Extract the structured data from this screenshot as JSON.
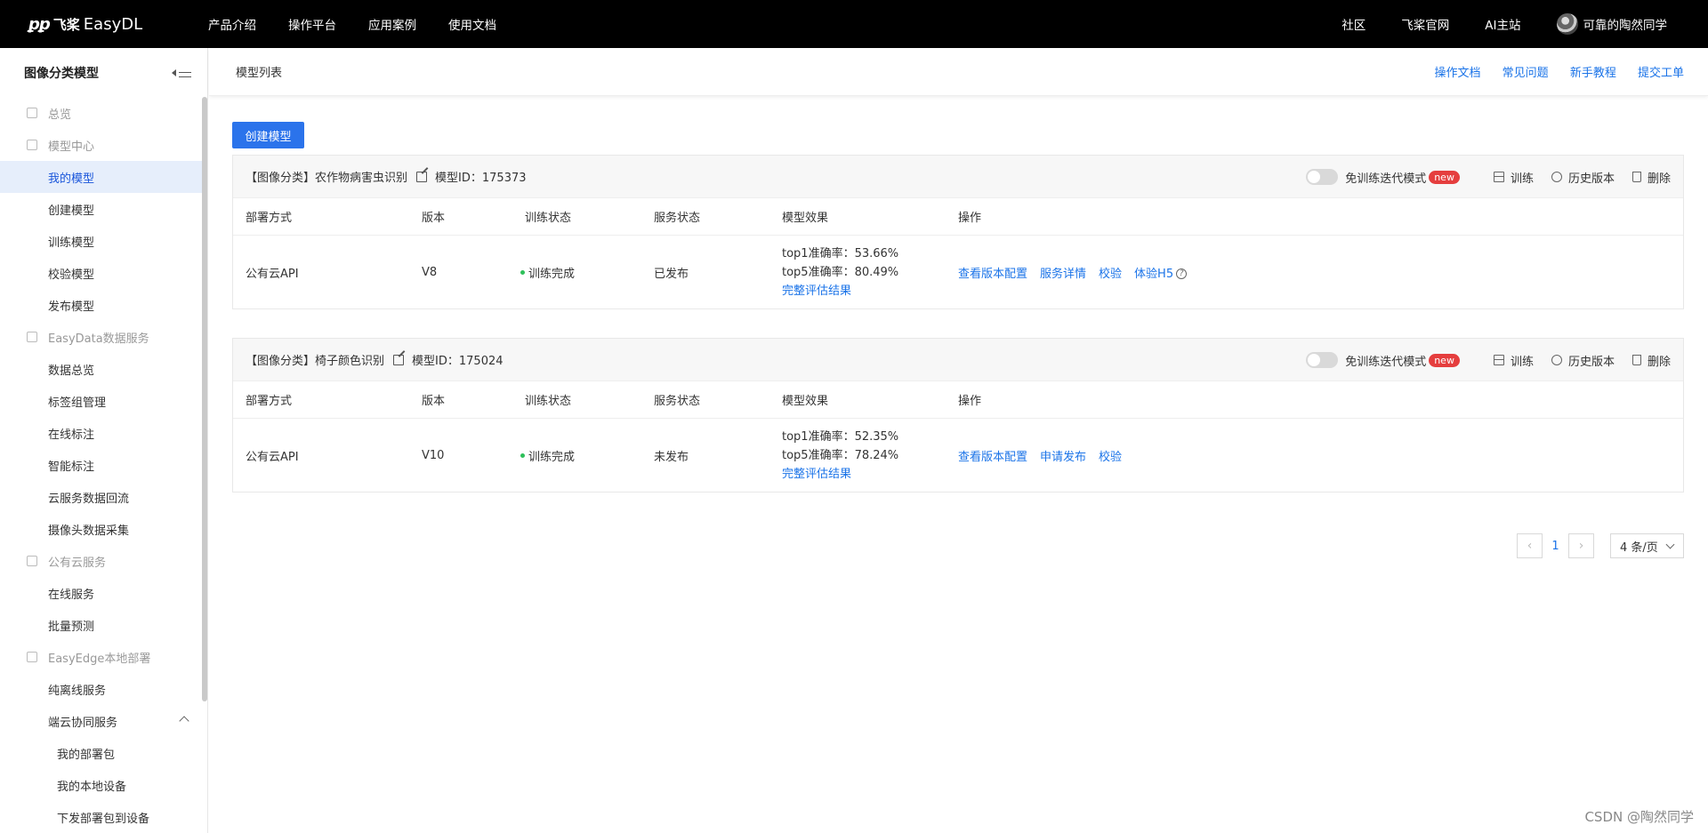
{
  "topnav": {
    "logo_mark": "ꝑꝑ",
    "logo_brand": "飞桨",
    "logo_product": "EasyDL",
    "menu": [
      "产品介绍",
      "操作平台",
      "应用案例",
      "使用文档"
    ],
    "right_links": [
      "社区",
      "飞桨官网",
      "AI主站"
    ],
    "username": "可靠的陶然同学"
  },
  "sidebar": {
    "title": "图像分类模型",
    "items": [
      {
        "label": "总览",
        "type": "group"
      },
      {
        "label": "模型中心",
        "type": "group"
      },
      {
        "label": "我的模型",
        "type": "item",
        "active": true
      },
      {
        "label": "创建模型",
        "type": "item"
      },
      {
        "label": "训练模型",
        "type": "item"
      },
      {
        "label": "校验模型",
        "type": "item"
      },
      {
        "label": "发布模型",
        "type": "item"
      },
      {
        "label": "EasyData数据服务",
        "type": "group"
      },
      {
        "label": "数据总览",
        "type": "item"
      },
      {
        "label": "标签组管理",
        "type": "item"
      },
      {
        "label": "在线标注",
        "type": "item"
      },
      {
        "label": "智能标注",
        "type": "item"
      },
      {
        "label": "云服务数据回流",
        "type": "item"
      },
      {
        "label": "摄像头数据采集",
        "type": "item"
      },
      {
        "label": "公有云服务",
        "type": "group"
      },
      {
        "label": "在线服务",
        "type": "item"
      },
      {
        "label": "批量预测",
        "type": "item"
      },
      {
        "label": "EasyEdge本地部署",
        "type": "group"
      },
      {
        "label": "纯离线服务",
        "type": "item"
      },
      {
        "label": "端云协同服务",
        "type": "item",
        "expanded": true
      },
      {
        "label": "我的部署包",
        "type": "sub"
      },
      {
        "label": "我的本地设备",
        "type": "sub"
      },
      {
        "label": "下发部署包到设备",
        "type": "sub"
      }
    ]
  },
  "main": {
    "breadcrumb": "模型列表",
    "header_links": [
      "操作文档",
      "常见问题",
      "新手教程",
      "提交工单"
    ],
    "create_button": "创建模型",
    "columns": [
      "部署方式",
      "版本",
      "训练状态",
      "服务状态",
      "模型效果",
      "操作"
    ],
    "toggle_label": "免训练迭代模式",
    "badge": "new",
    "actions": {
      "train": "训练",
      "history": "历史版本",
      "delete": "删除"
    },
    "models": [
      {
        "category": "【图像分类】",
        "name": "农作物病害虫识别",
        "id_label": "模型ID：175373",
        "deploy": "公有云API",
        "version": "V8",
        "train_status": "训练完成",
        "service_status": "已发布",
        "top1": "top1准确率：53.66%",
        "top5": "top5准确率：80.49%",
        "eval_link": "完整评估结果",
        "ops": [
          "查看版本配置",
          "服务详情",
          "校验",
          "体验H5"
        ],
        "has_help": true
      },
      {
        "category": "【图像分类】",
        "name": "椅子颜色识别",
        "id_label": "模型ID：175024",
        "deploy": "公有云API",
        "version": "V10",
        "train_status": "训练完成",
        "service_status": "未发布",
        "top1": "top1准确率：52.35%",
        "top5": "top5准确率：78.24%",
        "eval_link": "完整评估结果",
        "ops": [
          "查看版本配置",
          "申请发布",
          "校验"
        ],
        "has_help": false
      }
    ],
    "pagination": {
      "current": "1",
      "page_size": "4 条/页"
    }
  },
  "watermark": "CSDN @陶然同学"
}
